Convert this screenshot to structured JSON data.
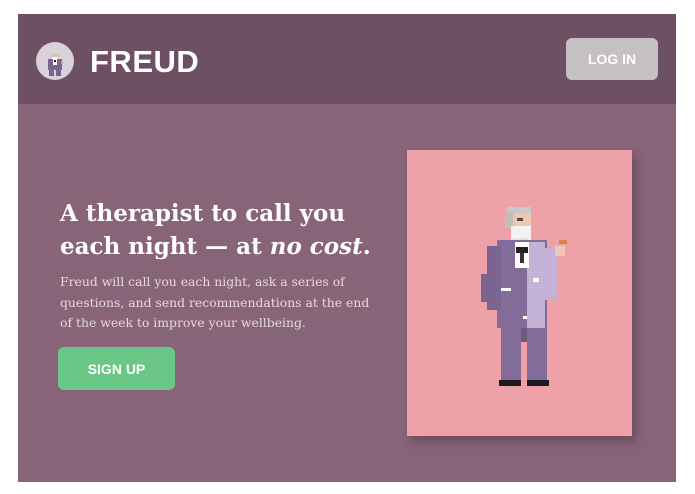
{
  "header": {
    "brand_name": "FREUD",
    "login_label": "LOG IN",
    "logo_icon": "freud-portrait-icon"
  },
  "hero": {
    "headline_part1": "A therapist to call you each night — at ",
    "headline_emphasis": "no cost",
    "headline_end": ".",
    "description": "Freud will call you each night, ask a series of questions, and send recommendations at the end of the week to improve your wellbeing.",
    "signup_label": "SIGN UP"
  },
  "illustration": {
    "subject": "pixel-art-freud-icon"
  },
  "colors": {
    "page_background": "#876478",
    "header_background": "#6e5065",
    "login_button": "#c4c0c3",
    "signup_button": "#6bc785",
    "illustration_background": "#eea2a8"
  }
}
